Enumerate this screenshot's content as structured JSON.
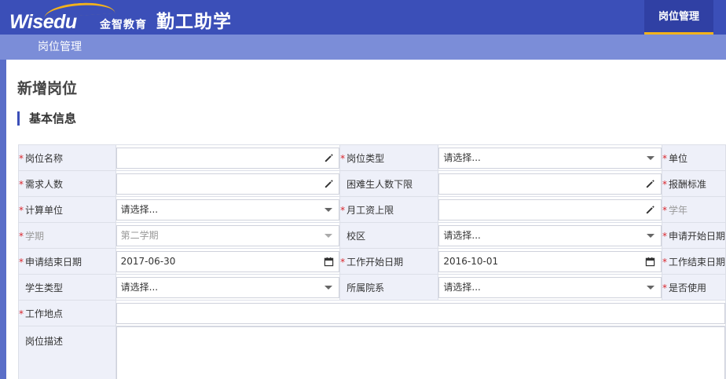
{
  "header": {
    "logo_text": "Wisedu",
    "brand_cn": "金智教育",
    "app_title": "勤工助学",
    "nav_tab": "岗位管理"
  },
  "subbar": {
    "tab": "岗位管理"
  },
  "page": {
    "title": "新增岗位",
    "section": "基本信息"
  },
  "colors": {
    "header": "#3b4fb8",
    "subbar": "#7b8dd8",
    "accent": "#f2b21c",
    "required": "#d9262c"
  },
  "form": {
    "rows": [
      [
        {
          "label": "岗位名称",
          "required": true,
          "type": "text",
          "value": "",
          "icon": "pencil-icon"
        },
        {
          "label": "岗位类型",
          "required": true,
          "type": "select",
          "value": "请选择..."
        },
        {
          "label": "单位",
          "required": true
        }
      ],
      [
        {
          "label": "需求人数",
          "required": true,
          "type": "text",
          "value": "",
          "icon": "pencil-icon"
        },
        {
          "label": "困难生人数下限",
          "required": false,
          "type": "text",
          "value": "",
          "icon": "pencil-icon"
        },
        {
          "label": "报酬标准",
          "required": true
        }
      ],
      [
        {
          "label": "计算单位",
          "required": true,
          "type": "select",
          "value": "请选择..."
        },
        {
          "label": "月工资上限",
          "required": true,
          "type": "text",
          "value": "",
          "icon": "pencil-icon"
        },
        {
          "label": "学年",
          "required": true,
          "disabled": true
        }
      ],
      [
        {
          "label": "学期",
          "required": true,
          "disabled": true,
          "type": "select",
          "value": "第二学期"
        },
        {
          "label": "校区",
          "required": false,
          "type": "select",
          "value": "请选择..."
        },
        {
          "label": "申请开始日期",
          "required": true
        }
      ],
      [
        {
          "label": "申请结束日期",
          "required": true,
          "type": "date",
          "value": "2017-06-30",
          "icon": "calendar-icon"
        },
        {
          "label": "工作开始日期",
          "required": true,
          "type": "date",
          "value": "2016-10-01",
          "icon": "calendar-icon"
        },
        {
          "label": "工作结束日期",
          "required": true
        }
      ],
      [
        {
          "label": "学生类型",
          "required": false,
          "type": "select",
          "value": "请选择..."
        },
        {
          "label": "所属院系",
          "required": false,
          "type": "select",
          "value": "请选择..."
        },
        {
          "label": "是否使用",
          "required": true
        }
      ]
    ],
    "location_label": "工作地点",
    "description_label": "岗位描述"
  }
}
